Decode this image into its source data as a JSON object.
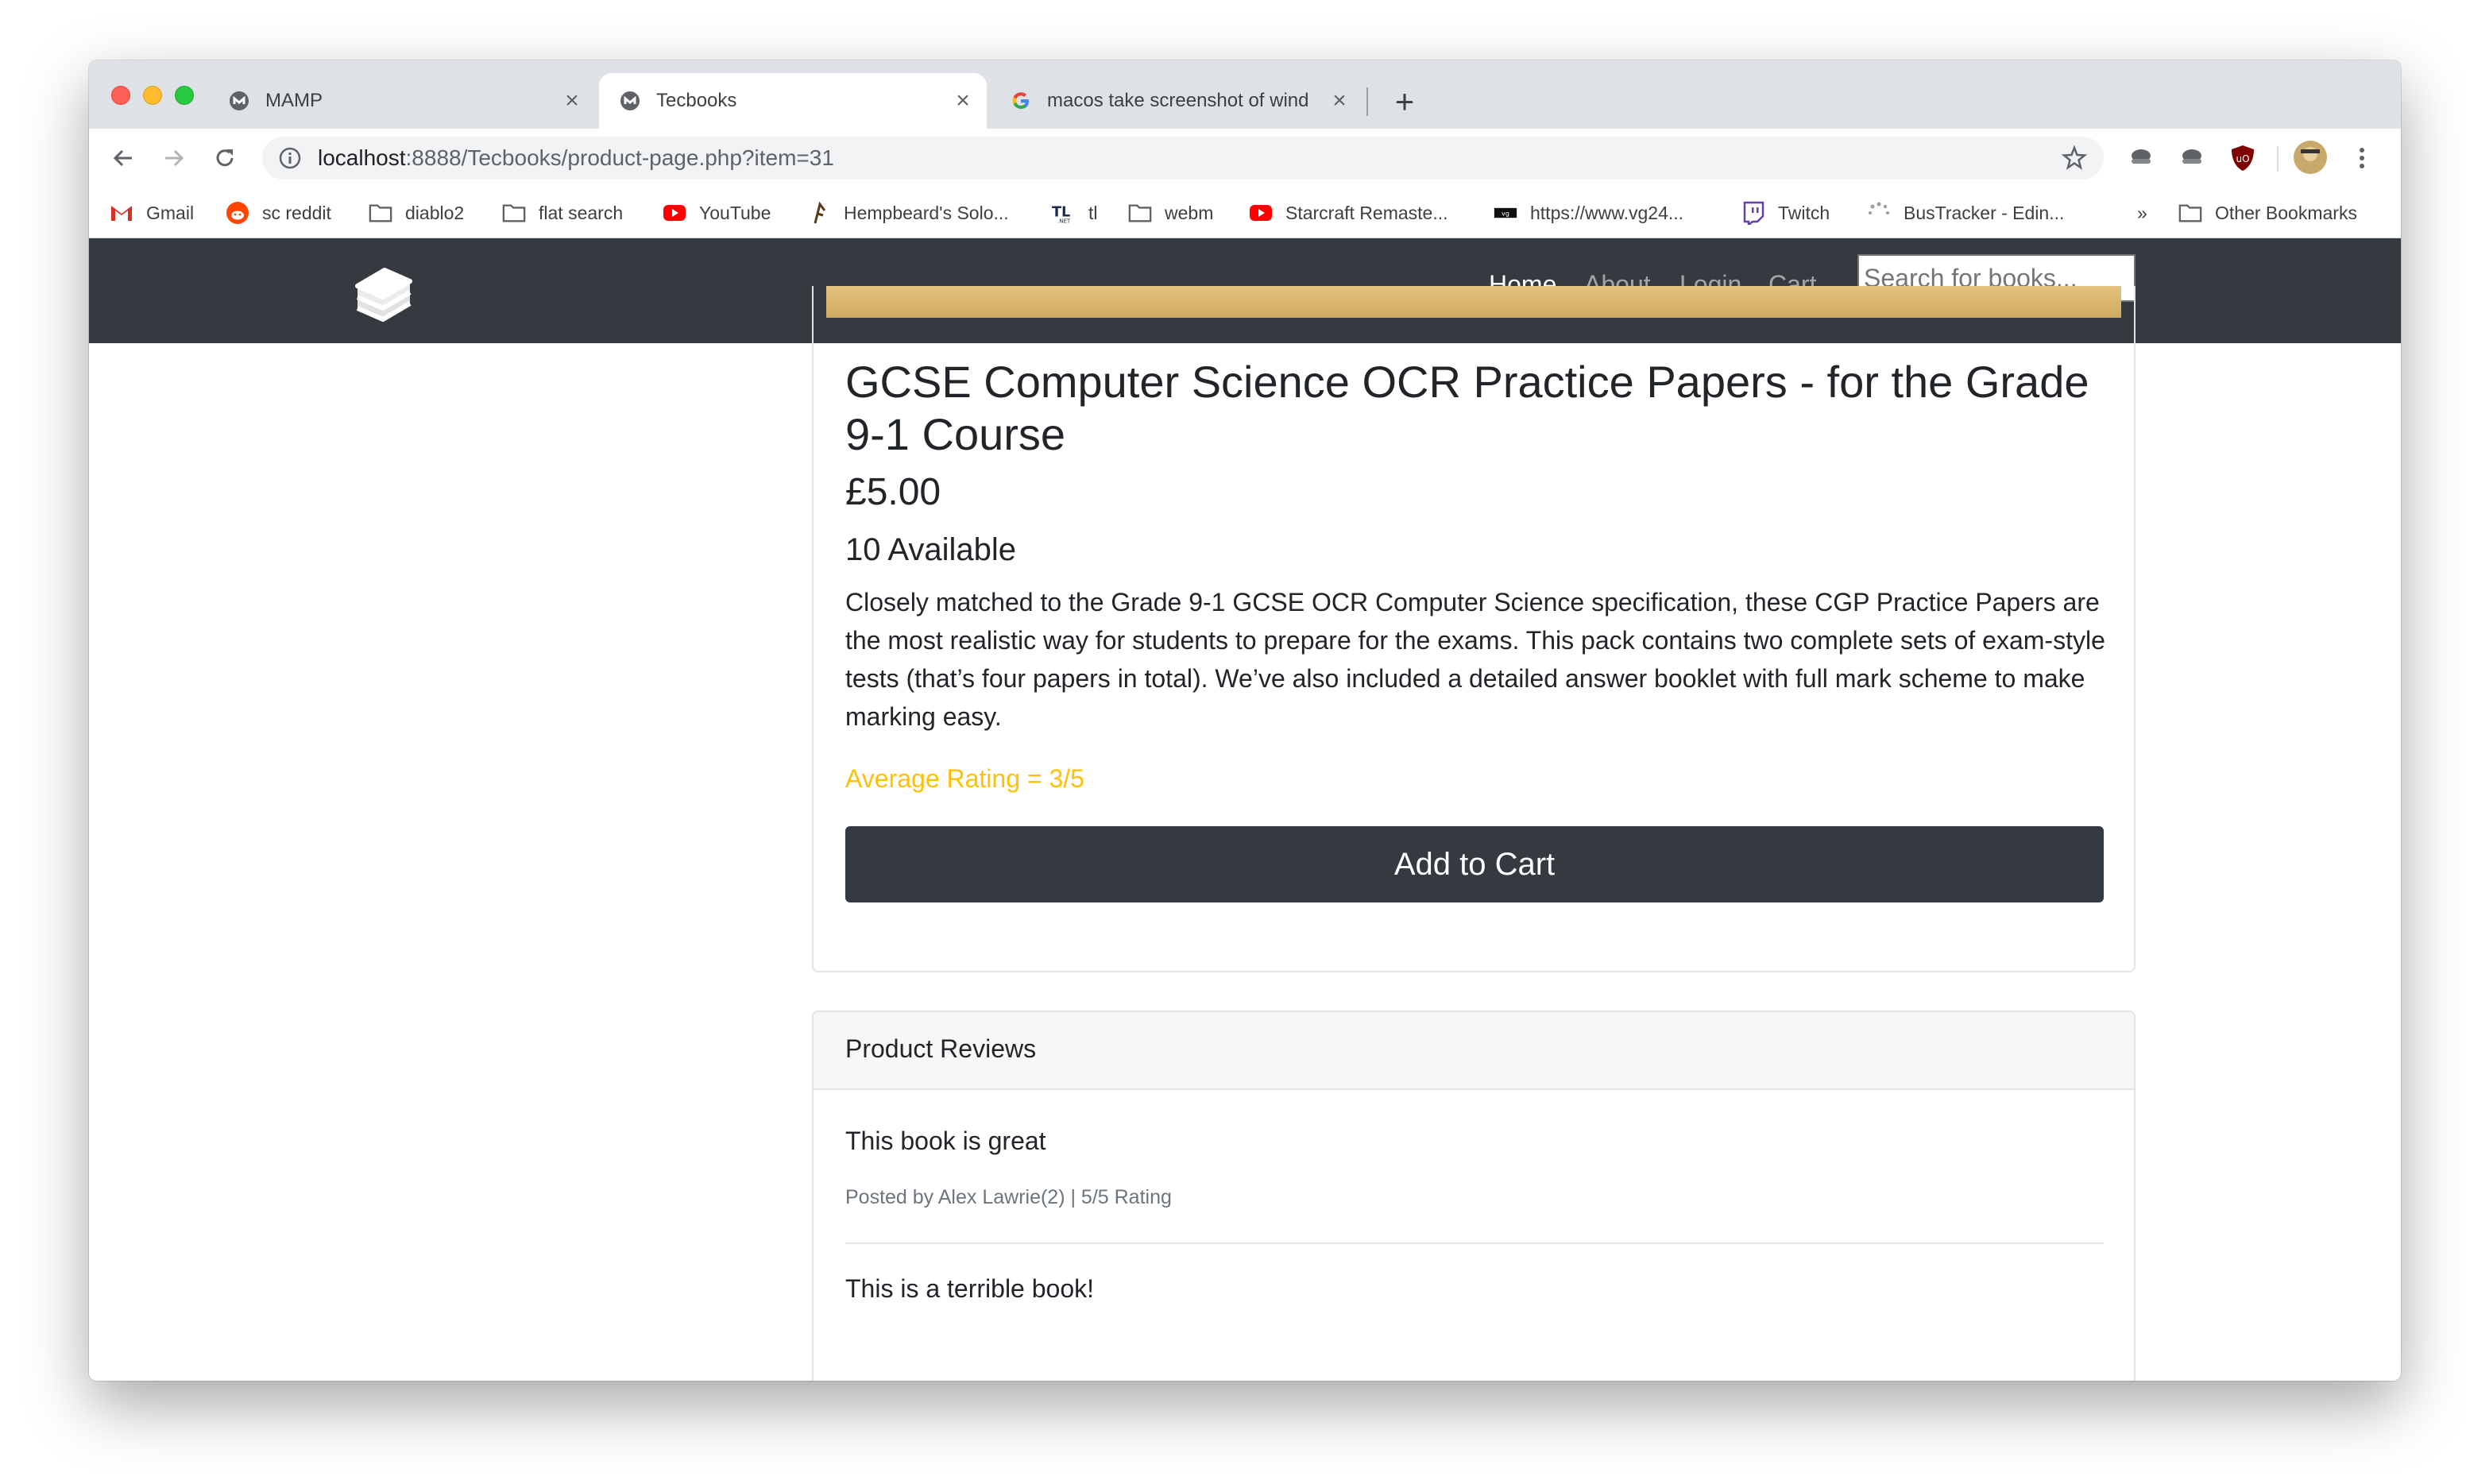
{
  "tabs": [
    {
      "title": "MAMP",
      "icon": "mamp-icon"
    },
    {
      "title": "Tecbooks",
      "icon": "mamp-icon",
      "active": true
    },
    {
      "title": "macos take screenshot of wind",
      "icon": "google-icon"
    }
  ],
  "address_bar": {
    "host": "localhost",
    "path": ":8888/Tecbooks/product-page.php?item=31"
  },
  "bookmarks": [
    {
      "label": "Gmail",
      "icon": "gmail-icon"
    },
    {
      "label": "sc reddit",
      "icon": "reddit-icon"
    },
    {
      "label": "diablo2",
      "icon": "folder-icon"
    },
    {
      "label": "flat search",
      "icon": "folder-icon"
    },
    {
      "label": "YouTube",
      "icon": "youtube-icon"
    },
    {
      "label": "Hempbeard's Solo...",
      "icon": "hempbeard-icon"
    },
    {
      "label": "tl",
      "icon": "tl-icon"
    },
    {
      "label": "webm",
      "icon": "folder-icon"
    },
    {
      "label": "Starcraft Remaste...",
      "icon": "youtube-icon"
    },
    {
      "label": "https://www.vg24...",
      "icon": "vg247-icon"
    },
    {
      "label": "Twitch",
      "icon": "twitch-icon"
    },
    {
      "label": "BusTracker - Edin...",
      "icon": "loading-icon"
    },
    {
      "label": "»",
      "icon": ""
    },
    {
      "label": "Other Bookmarks",
      "icon": "folder-icon"
    }
  ],
  "navbar": {
    "links": [
      "Home",
      "About",
      "Login",
      "Cart"
    ],
    "search_placeholder": "Search for books..."
  },
  "product": {
    "title": "GCSE Computer Science OCR Practice Papers - for the Grade 9-1 Course",
    "price": "£5.00",
    "availability": "10 Available",
    "description": "Closely matched to the Grade 9-1 GCSE OCR Computer Science specification, these CGP Practice Papers are the most realistic way for students to prepare for the exams. This pack contains two complete sets of exam-style tests (that’s four papers in total). We’ve also included a detailed answer booklet with full mark scheme to make marking easy.",
    "rating": "Average Rating = 3/5",
    "add_to_cart": "Add to Cart"
  },
  "reviews": {
    "header": "Product Reviews",
    "items": [
      {
        "text": "This book is great",
        "meta": "Posted by Alex Lawrie(2) | 5/5 Rating"
      },
      {
        "text": "This is a terrible book!",
        "meta": ""
      }
    ]
  },
  "colors": {
    "navbar": "#343a40",
    "rating": "#ffc107",
    "button": "#343a40"
  }
}
